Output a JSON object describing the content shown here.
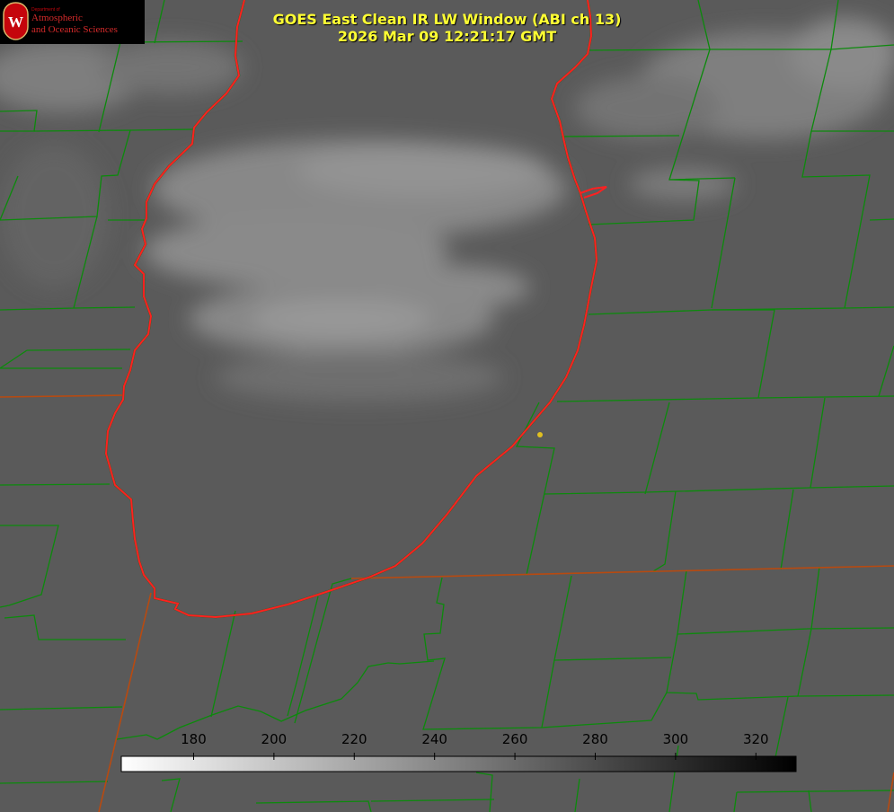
{
  "title": {
    "line1": "GOES East Clean IR LW Window (ABI ch 13)",
    "line2": "2026 Mar 09 12:21:17 GMT"
  },
  "logo": {
    "small": "Department of",
    "line1": "Atmospheric",
    "line2": "and Oceanic Sciences",
    "seal_letter": "W"
  },
  "colorbar": {
    "min": 162,
    "max": 330,
    "ticks": [
      "180",
      "200",
      "220",
      "240",
      "260",
      "280",
      "300",
      "320"
    ],
    "gradient_start": "#ffffff",
    "gradient_end": "#000000"
  },
  "colors": {
    "background": "#5c5c5c",
    "county_lines": "#0c8a0c",
    "state_lines": "#b84a10",
    "coastline": "#ff2020",
    "title_text": "#ffff33",
    "marker": "#e0c020"
  },
  "icons": [
    "wisconsin-seal-icon",
    "location-marker-icon"
  ]
}
